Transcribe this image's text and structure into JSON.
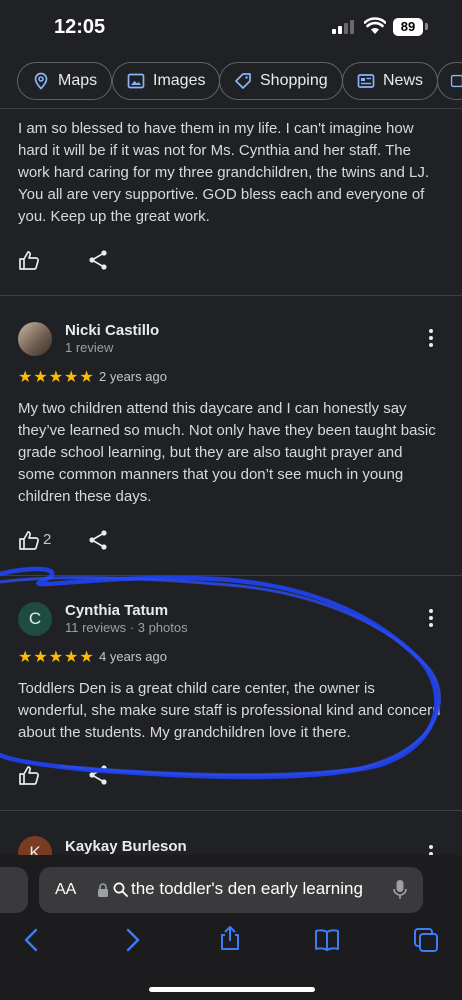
{
  "status": {
    "time": "12:05",
    "battery": "89"
  },
  "chips": [
    {
      "label": "Maps",
      "icon": "map-pin-icon"
    },
    {
      "label": "Images",
      "icon": "image-icon"
    },
    {
      "label": "Shopping",
      "icon": "tag-icon"
    },
    {
      "label": "News",
      "icon": "newspaper-icon"
    }
  ],
  "reviews": [
    {
      "text": "I am so blessed to have them in my life. I can't imagine how hard it will be if it was not for Ms. Cynthia and her staff. The work hard caring for my three grandchildren, the twins and LJ. You all are very supportive. GOD bless each and everyone of you. Keep up the great work.",
      "likes": ""
    },
    {
      "author": "Nicki Castillo",
      "meta": "1 review",
      "stars": "★★★★★",
      "rating": 5,
      "ago": "2 years ago",
      "text": "My two children attend this daycare and I can honestly say they’ve learned so much. Not only have they been taught basic grade school learning, but they are also taught prayer and some common manners that you don’t see much in young children these days.",
      "likes": "2"
    },
    {
      "author": "Cynthia Tatum",
      "initial": "C",
      "meta": "11 reviews · 3 photos",
      "stars": "★★★★★",
      "rating": 5,
      "ago": "4 years ago",
      "text": "Toddlers Den is a great child care center, the owner is wonderful, she make sure staff is professional kind and concern about the students. My grandchildren love it there.",
      "likes": ""
    },
    {
      "author": "Kaykay Burleson",
      "initial": "K"
    }
  ],
  "browser": {
    "aa_label": "AA",
    "url": "the toddler's den early learning"
  },
  "colors": {
    "background": "#202124",
    "stars": "#fbbc04",
    "annotation": "#1f3fe0",
    "avatar_c": "#1e4d40"
  }
}
